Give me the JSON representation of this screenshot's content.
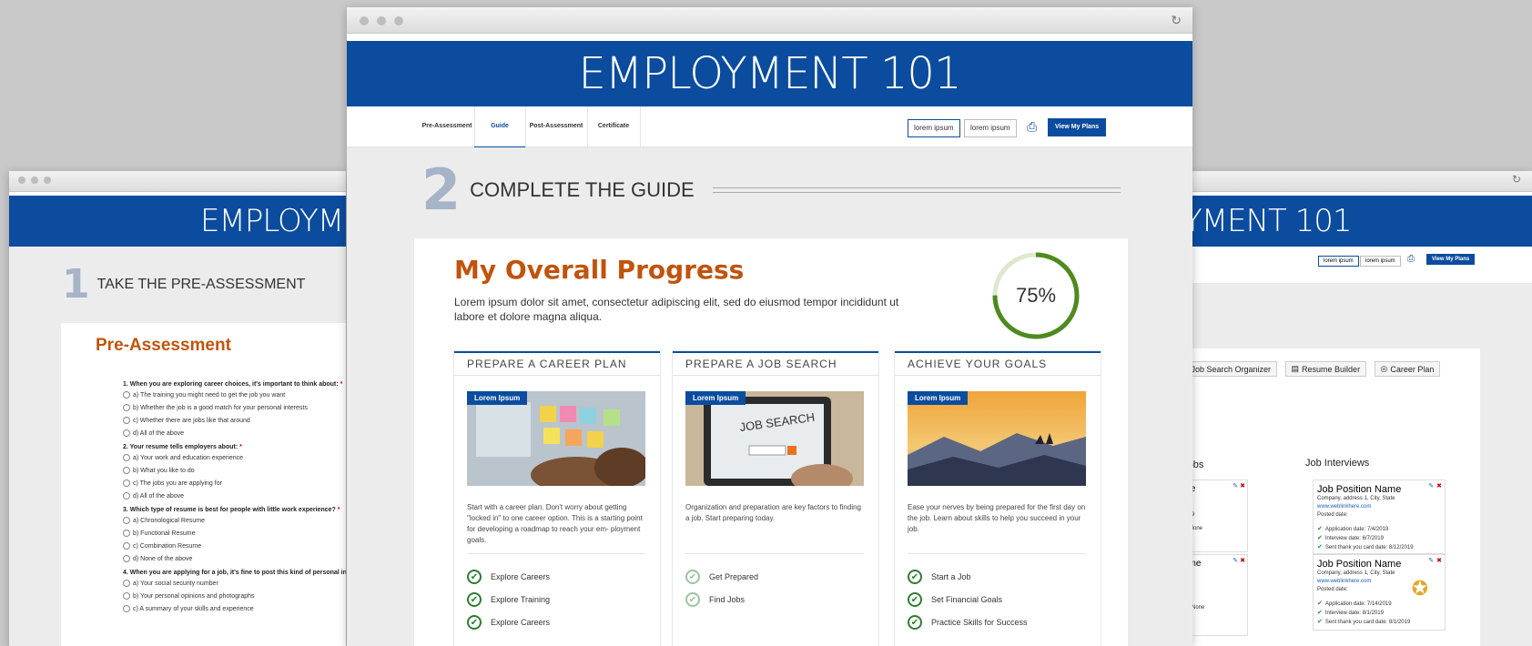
{
  "left": {
    "banner": "EMPLOYME",
    "step_num": "1",
    "step_text": "TAKE THE PRE-ASSESSMENT",
    "heading": "Pre-Assessment",
    "questions": [
      {
        "q": "1. When you are exploring career choices, it's important to think about:",
        "req": "*",
        "opts": [
          "a) The training you might need to get the job you want",
          "b) Whether the job is a good match for your personal interests",
          "c) Whether there are jobs like that around",
          "d) All of the above"
        ]
      },
      {
        "q": "2. Your resume tells employers about:",
        "req": "*",
        "opts": [
          "a) Your work and education experience",
          "b) What you like to do",
          "c) The jobs you are applying for",
          "d) All of the above"
        ]
      },
      {
        "q": "3. Which type of resume is best for people with little work experience?",
        "req": "*",
        "opts": [
          "a) Chronological Resume",
          "b) Functional Resume",
          "c) Combination Resume",
          "d) None of the above"
        ]
      },
      {
        "q": "4. When you are applying for a job, it's fine to post this kind of personal in",
        "req": "",
        "opts": [
          "a) Your social security number",
          "b) Your personal opinions and photographs",
          "c) A summary of your skills and experience"
        ]
      }
    ]
  },
  "right": {
    "banner": "YMENT 101",
    "pill1": "lorem ipsum",
    "pill2": "lorem ipsum",
    "button": "View My Plans",
    "tabs": [
      "Job Search Organizer",
      "Resume Builder",
      "Career Plan"
    ],
    "ds": "ds",
    "col1_title": "b Jobs",
    "col2_title": "Job Interviews",
    "card_a": {
      "name": "ame",
      "lines": [
        "e",
        "2/2019",
        "site:  None"
      ]
    },
    "card_b": {
      "name": "Vame",
      "lines": [
        "ite",
        "",
        "y",
        "e",
        "date:  None"
      ]
    },
    "interview_1": {
      "name": "Job Position Name",
      "addr": "Company, address 1, City, State",
      "link": "www.weblinkhere.com",
      "posted": "Posted date:",
      "items": [
        "Application date: 7/4/2019",
        "Interview date: 6/7/2019",
        "Sent thank you card date: 8/12/2019"
      ]
    },
    "interview_2": {
      "name": "Job Position Name",
      "addr": "Company, address 1, City, State",
      "link": "www.weblinkhere.com",
      "posted": "Posted date:",
      "items": [
        "Application date: 7/14/2019",
        "Interview date: 8/1/2019",
        "Sent thank you card date: 8/1/2019"
      ]
    }
  },
  "main": {
    "banner": "EMPLOYMENT 101",
    "nav": [
      "Pre-Assessment",
      "Guide",
      "Post-Assessment",
      "Certificate"
    ],
    "pill1": "lorem ipsum",
    "pill2": "lorem ipsum",
    "view_plans": "View My Plans",
    "step_num": "2",
    "step_text": "COMPLETE THE GUIDE",
    "progress_title": "My Overall Progress",
    "progress_desc": "Lorem ipsum dolor sit amet, consectetur adipiscing elit, sed do eiusmod tempor incididunt ut labore et dolore magna aliqua.",
    "progress_value": 75,
    "progress_label": "75%",
    "columns": [
      {
        "title": "PREPARE A CAREER PLAN",
        "tag": "Lorem Ipsum",
        "desc": "Start with a career plan. Don't worry about getting \"locked in\" to one career option. This is a starting point for developing a roadmap to reach your em- ployment goals.",
        "items": [
          "Explore Careers",
          "Explore Training",
          "Explore Careers"
        ],
        "done": [
          true,
          true,
          true
        ]
      },
      {
        "title": "PREPARE A JOB SEARCH",
        "tag": "Lorem Ipsum",
        "desc": "Organization and preparation are key factors to finding a job. Start preparing today.",
        "items": [
          "Get Prepared",
          "Find Jobs"
        ],
        "done": [
          false,
          false
        ]
      },
      {
        "title": "ACHIEVE YOUR GOALS",
        "tag": "Lorem Ipsum",
        "desc": "Ease your nerves by being prepared for the first day on the job. Learn about skills to help you succeed in your job.",
        "items": [
          "Start a Job",
          "Set Financial Goals",
          "Practice Skills for Success"
        ],
        "done": [
          true,
          true,
          true
        ]
      }
    ]
  }
}
